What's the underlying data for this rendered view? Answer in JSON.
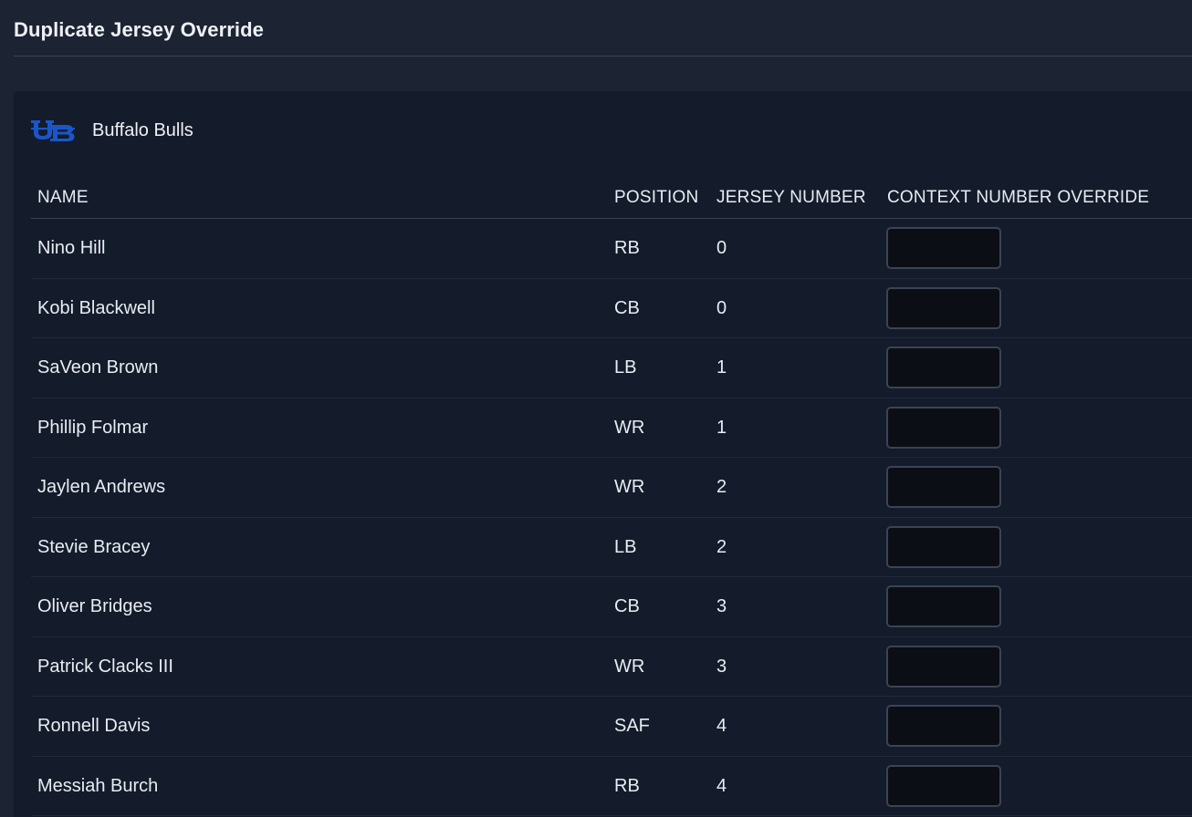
{
  "page": {
    "title": "Duplicate Jersey Override"
  },
  "team": {
    "name": "Buffalo Bulls",
    "logo_icon": "ub-logo-icon",
    "logo_color": "#1a56c8"
  },
  "table": {
    "columns": {
      "name": "NAME",
      "position": "POSITION",
      "jersey": "JERSEY NUMBER",
      "override": "CONTEXT NUMBER OVERRIDE"
    },
    "rows": [
      {
        "name": "Nino Hill",
        "position": "RB",
        "jersey": "0",
        "override": ""
      },
      {
        "name": "Kobi Blackwell",
        "position": "CB",
        "jersey": "0",
        "override": ""
      },
      {
        "name": "SaVeon Brown",
        "position": "LB",
        "jersey": "1",
        "override": ""
      },
      {
        "name": "Phillip Folmar",
        "position": "WR",
        "jersey": "1",
        "override": ""
      },
      {
        "name": "Jaylen Andrews",
        "position": "WR",
        "jersey": "2",
        "override": ""
      },
      {
        "name": "Stevie Bracey",
        "position": "LB",
        "jersey": "2",
        "override": ""
      },
      {
        "name": "Oliver Bridges",
        "position": "CB",
        "jersey": "3",
        "override": ""
      },
      {
        "name": "Patrick Clacks III",
        "position": "WR",
        "jersey": "3",
        "override": ""
      },
      {
        "name": "Ronnell Davis",
        "position": "SAF",
        "jersey": "4",
        "override": ""
      },
      {
        "name": "Messiah Burch",
        "position": "RB",
        "jersey": "4",
        "override": ""
      }
    ]
  }
}
